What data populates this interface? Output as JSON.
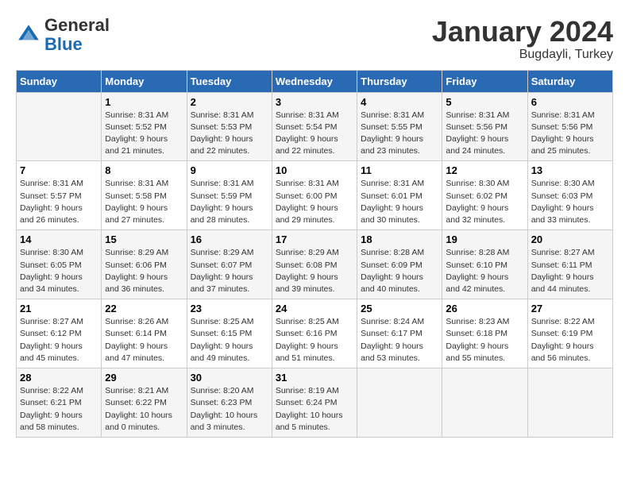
{
  "header": {
    "logo_line1": "General",
    "logo_line2": "Blue",
    "title": "January 2024",
    "subtitle": "Bugdayli, Turkey"
  },
  "days_of_week": [
    "Sunday",
    "Monday",
    "Tuesday",
    "Wednesday",
    "Thursday",
    "Friday",
    "Saturday"
  ],
  "weeks": [
    [
      {
        "day": "",
        "info": ""
      },
      {
        "day": "1",
        "info": "Sunrise: 8:31 AM\nSunset: 5:52 PM\nDaylight: 9 hours\nand 21 minutes."
      },
      {
        "day": "2",
        "info": "Sunrise: 8:31 AM\nSunset: 5:53 PM\nDaylight: 9 hours\nand 22 minutes."
      },
      {
        "day": "3",
        "info": "Sunrise: 8:31 AM\nSunset: 5:54 PM\nDaylight: 9 hours\nand 22 minutes."
      },
      {
        "day": "4",
        "info": "Sunrise: 8:31 AM\nSunset: 5:55 PM\nDaylight: 9 hours\nand 23 minutes."
      },
      {
        "day": "5",
        "info": "Sunrise: 8:31 AM\nSunset: 5:56 PM\nDaylight: 9 hours\nand 24 minutes."
      },
      {
        "day": "6",
        "info": "Sunrise: 8:31 AM\nSunset: 5:56 PM\nDaylight: 9 hours\nand 25 minutes."
      }
    ],
    [
      {
        "day": "7",
        "info": "Sunrise: 8:31 AM\nSunset: 5:57 PM\nDaylight: 9 hours\nand 26 minutes."
      },
      {
        "day": "8",
        "info": "Sunrise: 8:31 AM\nSunset: 5:58 PM\nDaylight: 9 hours\nand 27 minutes."
      },
      {
        "day": "9",
        "info": "Sunrise: 8:31 AM\nSunset: 5:59 PM\nDaylight: 9 hours\nand 28 minutes."
      },
      {
        "day": "10",
        "info": "Sunrise: 8:31 AM\nSunset: 6:00 PM\nDaylight: 9 hours\nand 29 minutes."
      },
      {
        "day": "11",
        "info": "Sunrise: 8:31 AM\nSunset: 6:01 PM\nDaylight: 9 hours\nand 30 minutes."
      },
      {
        "day": "12",
        "info": "Sunrise: 8:30 AM\nSunset: 6:02 PM\nDaylight: 9 hours\nand 32 minutes."
      },
      {
        "day": "13",
        "info": "Sunrise: 8:30 AM\nSunset: 6:03 PM\nDaylight: 9 hours\nand 33 minutes."
      }
    ],
    [
      {
        "day": "14",
        "info": "Sunrise: 8:30 AM\nSunset: 6:05 PM\nDaylight: 9 hours\nand 34 minutes."
      },
      {
        "day": "15",
        "info": "Sunrise: 8:29 AM\nSunset: 6:06 PM\nDaylight: 9 hours\nand 36 minutes."
      },
      {
        "day": "16",
        "info": "Sunrise: 8:29 AM\nSunset: 6:07 PM\nDaylight: 9 hours\nand 37 minutes."
      },
      {
        "day": "17",
        "info": "Sunrise: 8:29 AM\nSunset: 6:08 PM\nDaylight: 9 hours\nand 39 minutes."
      },
      {
        "day": "18",
        "info": "Sunrise: 8:28 AM\nSunset: 6:09 PM\nDaylight: 9 hours\nand 40 minutes."
      },
      {
        "day": "19",
        "info": "Sunrise: 8:28 AM\nSunset: 6:10 PM\nDaylight: 9 hours\nand 42 minutes."
      },
      {
        "day": "20",
        "info": "Sunrise: 8:27 AM\nSunset: 6:11 PM\nDaylight: 9 hours\nand 44 minutes."
      }
    ],
    [
      {
        "day": "21",
        "info": "Sunrise: 8:27 AM\nSunset: 6:12 PM\nDaylight: 9 hours\nand 45 minutes."
      },
      {
        "day": "22",
        "info": "Sunrise: 8:26 AM\nSunset: 6:14 PM\nDaylight: 9 hours\nand 47 minutes."
      },
      {
        "day": "23",
        "info": "Sunrise: 8:25 AM\nSunset: 6:15 PM\nDaylight: 9 hours\nand 49 minutes."
      },
      {
        "day": "24",
        "info": "Sunrise: 8:25 AM\nSunset: 6:16 PM\nDaylight: 9 hours\nand 51 minutes."
      },
      {
        "day": "25",
        "info": "Sunrise: 8:24 AM\nSunset: 6:17 PM\nDaylight: 9 hours\nand 53 minutes."
      },
      {
        "day": "26",
        "info": "Sunrise: 8:23 AM\nSunset: 6:18 PM\nDaylight: 9 hours\nand 55 minutes."
      },
      {
        "day": "27",
        "info": "Sunrise: 8:22 AM\nSunset: 6:19 PM\nDaylight: 9 hours\nand 56 minutes."
      }
    ],
    [
      {
        "day": "28",
        "info": "Sunrise: 8:22 AM\nSunset: 6:21 PM\nDaylight: 9 hours\nand 58 minutes."
      },
      {
        "day": "29",
        "info": "Sunrise: 8:21 AM\nSunset: 6:22 PM\nDaylight: 10 hours\nand 0 minutes."
      },
      {
        "day": "30",
        "info": "Sunrise: 8:20 AM\nSunset: 6:23 PM\nDaylight: 10 hours\nand 3 minutes."
      },
      {
        "day": "31",
        "info": "Sunrise: 8:19 AM\nSunset: 6:24 PM\nDaylight: 10 hours\nand 5 minutes."
      },
      {
        "day": "",
        "info": ""
      },
      {
        "day": "",
        "info": ""
      },
      {
        "day": "",
        "info": ""
      }
    ]
  ]
}
